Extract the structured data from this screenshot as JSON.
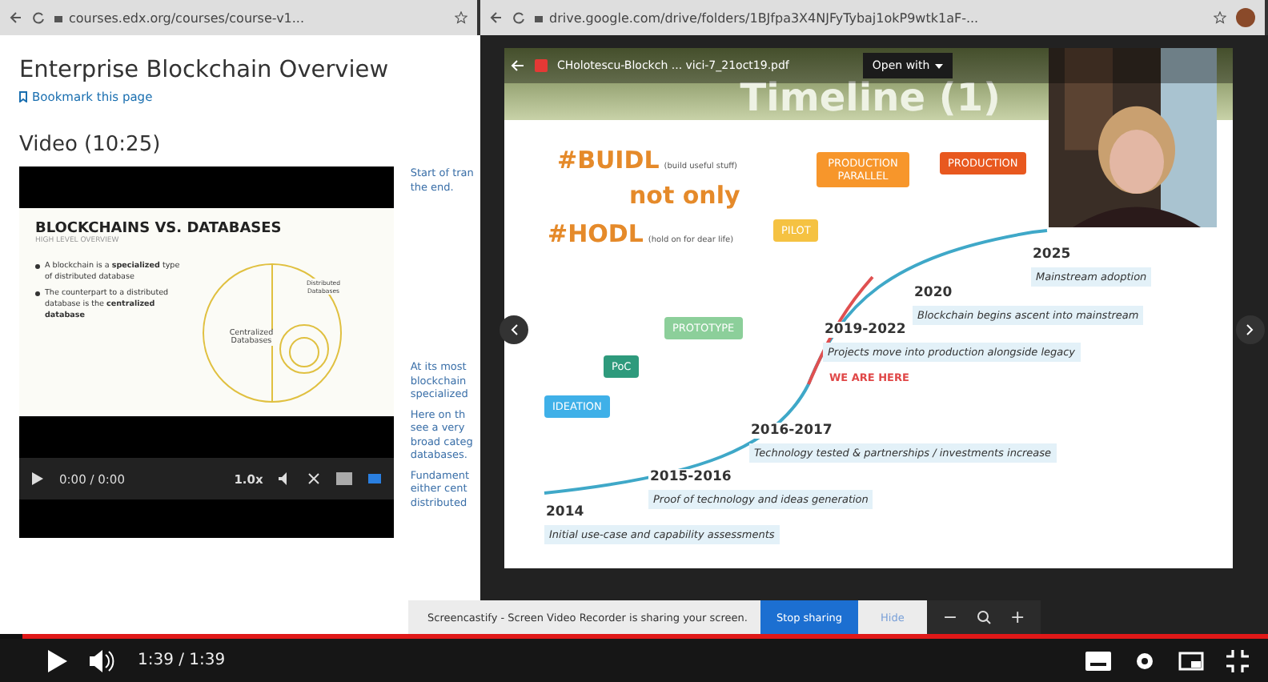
{
  "left_browser": {
    "url": "courses.edx.org/courses/course-v1..."
  },
  "right_browser": {
    "url": "drive.google.com/drive/folders/1BJfpa3X4NJFyTybaj1okP9wtk1aF-..."
  },
  "course": {
    "title": "Enterprise Blockchain Overview",
    "bookmark": "Bookmark this page",
    "video_heading": "Video (10:25)",
    "video": {
      "slide_title": "BLOCKCHAINS VS. DATABASES",
      "slide_subtitle": "HIGH LEVEL OVERVIEW",
      "bullets": [
        "A blockchain is a **specialized** type of distributed database",
        "The counterpart to a distributed database is the **centralized database**"
      ],
      "centralized": "Centralized Databases",
      "distributed": "Distributed Databases",
      "time": "0:00 / 0:00",
      "speed": "1.0x"
    },
    "transcript": [
      {
        "lines": [
          "Start of tran",
          "the end."
        ]
      },
      {
        "lines": [
          "At its most",
          "blockchain",
          "specialized"
        ]
      },
      {
        "lines": [
          "Here on th",
          "see a very",
          "broad categ",
          "databases."
        ]
      },
      {
        "lines": [
          "Fundament",
          "either cent",
          "distributed"
        ]
      }
    ]
  },
  "viewer": {
    "file_name": "CHolotescu-Blockch ... vici-7_21oct19.pdf",
    "open_with": "Open with",
    "slide": {
      "title": "Timeline (1)",
      "tags": [
        {
          "tag": "#BUIDL",
          "note": "(build useful stuff)"
        },
        {
          "tag": "#HODL",
          "note": "(hold on for dear life)"
        }
      ],
      "joiner": "not only",
      "stages": [
        {
          "label": "PRODUCTION PARALLEL",
          "color": "#f7962b"
        },
        {
          "label": "PRODUCTION",
          "color": "#e8581f"
        },
        {
          "label": "PILOT",
          "color": "#f5c242"
        },
        {
          "label": "PROTOTYPE",
          "color": "#8ccf9a"
        },
        {
          "label": "PoC",
          "color": "#2e9a7c"
        },
        {
          "label": "IDEATION",
          "color": "#3fb0e8"
        }
      ],
      "marker": "WE ARE HERE",
      "milestones": [
        {
          "year": "2025",
          "text": "Mainstream adoption"
        },
        {
          "year": "2020",
          "text": "Blockchain begins ascent into mainstream"
        },
        {
          "year": "2019-2022",
          "text": "Projects move into production alongside legacy"
        },
        {
          "year": "2016-2017",
          "text": "Technology tested & partnerships / investments increase"
        },
        {
          "year": "2015-2016",
          "text": "Proof of technology and ideas generation"
        },
        {
          "year": "2014",
          "text": "Initial use-case and capability assessments"
        }
      ]
    }
  },
  "screencastify": {
    "message": "Screencastify - Screen Video Recorder is sharing your screen.",
    "stop": "Stop sharing",
    "hide": "Hide",
    "zoom_out": "−",
    "zoom_in": "+"
  },
  "player": {
    "time": "1:39 / 1:39",
    "level": 1
  }
}
